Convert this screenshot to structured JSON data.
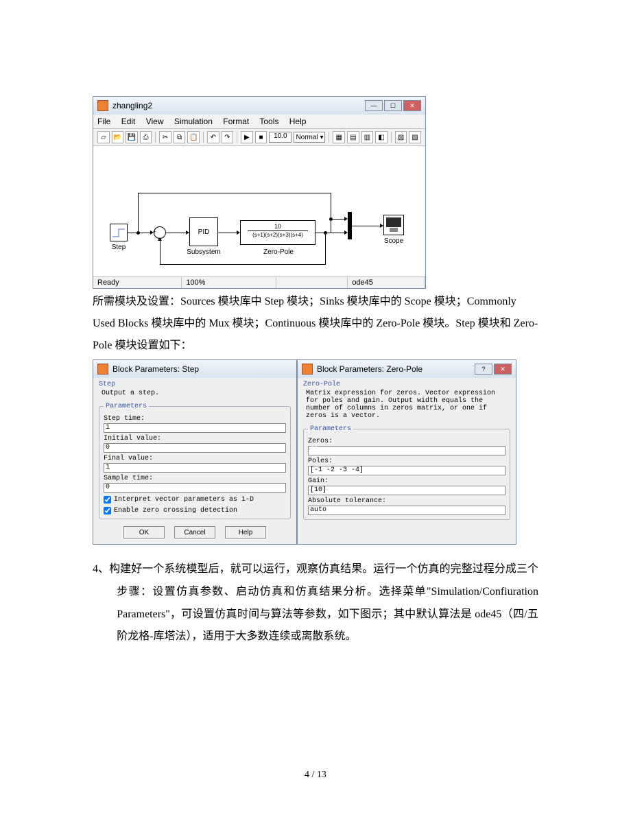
{
  "simulink": {
    "title": "zhangling2",
    "menus": [
      "File",
      "Edit",
      "View",
      "Simulation",
      "Format",
      "Tools",
      "Help"
    ],
    "toolbar": {
      "stop_time": "10.0",
      "mode": "Normal"
    },
    "status": {
      "left": "Ready",
      "zoom": "100%",
      "solver": "ode45"
    },
    "blocks": {
      "step": "Step",
      "subsystem_inner": "PID",
      "subsystem": "Subsystem",
      "tf_num": "10",
      "tf_den": "(s+1)(s+2)(s+3)(s+4)",
      "zero_pole": "Zero-Pole",
      "scope": "Scope"
    }
  },
  "body_para1": "所需模块及设置：Sources 模块库中 Step 模块；Sinks 模块库中的 Scope 模块；Commonly Used Blocks 模块库中的 Mux 模块；Continuous 模块库中的 Zero-Pole 模块。Step 模块和 Zero-Pole 模块设置如下：",
  "step_dlg": {
    "title": "Block Parameters: Step",
    "section": "Step",
    "desc": "Output a step.",
    "params_legend": "Parameters",
    "labels": {
      "step_time": "Step time:",
      "initial": "Initial value:",
      "final": "Final value:",
      "sample": "Sample time:"
    },
    "values": {
      "step_time": "1",
      "initial": "0",
      "final": "1",
      "sample": "0"
    },
    "cb1": "Interpret vector parameters as 1-D",
    "cb2": "Enable zero crossing detection",
    "buttons": {
      "ok": "OK",
      "cancel": "Cancel",
      "help": "Help"
    }
  },
  "zp_dlg": {
    "title": "Block Parameters: Zero-Pole",
    "section": "Zero-Pole",
    "desc": "Matrix expression for zeros.  Vector expression for poles and gain. Output width equals the number of columns in zeros matrix, or one if zeros is a vector.",
    "params_legend": "Parameters",
    "labels": {
      "zeros": "Zeros:",
      "poles": "Poles:",
      "gain": "Gain:",
      "abstol": "Absolute tolerance:"
    },
    "values": {
      "zeros": "[]",
      "poles": "[-1 -2 -3 -4]",
      "gain": "[10]",
      "abstol": "auto"
    }
  },
  "body_para2": "4、构建好一个系统模型后，就可以运行，观察仿真结果。运行一个仿真的完整过程分成三个步骤：设置仿真参数、启动仿真和仿真结果分析。选择菜单\"Simulation/Confiuration Parameters\"，可设置仿真时间与算法等参数，如下图示；其中默认算法是 ode45（四/五阶龙格-库塔法），适用于大多数连续或离散系统。",
  "page_number": "4 / 13"
}
